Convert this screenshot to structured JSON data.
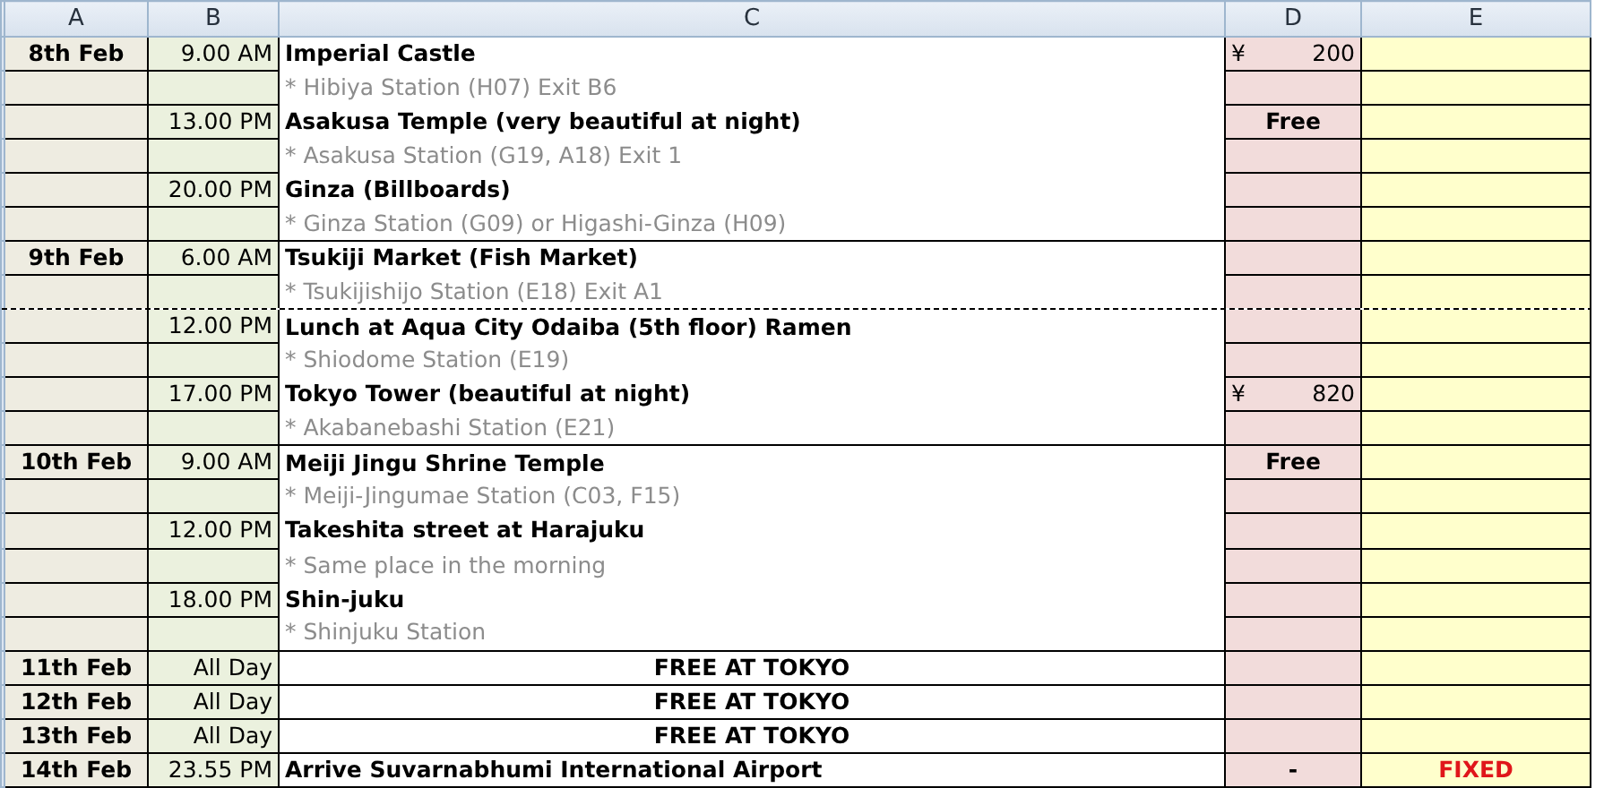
{
  "columns": [
    "A",
    "B",
    "C",
    "D",
    "E"
  ],
  "rows": [
    {
      "date": "8th Feb",
      "time": "9.00 AM",
      "activity": "Imperial Castle",
      "kind": "place",
      "cost": {
        "symbol": "¥",
        "amount": "200"
      }
    },
    {
      "activity": "* Hibiya Station (H07) Exit B6",
      "kind": "note"
    },
    {
      "time": "13.00 PM",
      "activity": "Asakusa Temple (very beautiful at night)",
      "kind": "place",
      "cost": {
        "text": "Free"
      }
    },
    {
      "activity": "* Asakusa Station (G19, A18) Exit 1",
      "kind": "note"
    },
    {
      "time": "20.00 PM",
      "activity": "Ginza (Billboards)",
      "kind": "place"
    },
    {
      "activity": "* Ginza Station (G09) or Higashi-Ginza (H09)",
      "kind": "note"
    },
    {
      "date": "9th Feb",
      "time": "6.00 AM",
      "activity": "Tsukiji Market (Fish Market)",
      "kind": "place"
    },
    {
      "activity": "* Tsukijishijo Station (E18) Exit A1",
      "kind": "note"
    },
    {
      "time": "12.00 PM",
      "activity": "Lunch at Aqua City Odaiba (5th floor) Ramen",
      "kind": "place",
      "dashed_divider": true
    },
    {
      "activity": "* Shiodome Station (E19)",
      "kind": "note"
    },
    {
      "time": "17.00 PM",
      "activity": "Tokyo Tower (beautiful at night)",
      "kind": "place",
      "cost": {
        "symbol": "¥",
        "amount": "820"
      }
    },
    {
      "activity": "* Akabanebashi Station (E21)",
      "kind": "note"
    },
    {
      "date": "10th Feb",
      "time": "9.00 AM",
      "activity": "Meiji Jingu Shrine Temple",
      "kind": "place",
      "cost": {
        "text": "Free"
      }
    },
    {
      "activity": "* Meiji-Jingumae Station (C03, F15)",
      "kind": "note"
    },
    {
      "time": "12.00 PM",
      "activity": "Takeshita street at Harajuku",
      "kind": "place"
    },
    {
      "activity": "* Same place in the morning",
      "kind": "note"
    },
    {
      "time": "18.00 PM",
      "activity": "Shin-juku",
      "kind": "place"
    },
    {
      "activity": "* Shinjuku Station",
      "kind": "note"
    },
    {
      "date": "11th Feb",
      "time": "All Day",
      "activity": "FREE AT TOKYO",
      "kind": "free"
    },
    {
      "date": "12th Feb",
      "time": "All Day",
      "activity": "FREE AT TOKYO",
      "kind": "free"
    },
    {
      "date": "13th Feb",
      "time": "All Day",
      "activity": "FREE AT TOKYO",
      "kind": "free"
    },
    {
      "date": "14th Feb",
      "time": "23.55 PM",
      "activity": "Arrive Suvarnabhumi International Airport",
      "kind": "place",
      "cost": {
        "text": "-"
      },
      "status": "FIXED"
    }
  ]
}
